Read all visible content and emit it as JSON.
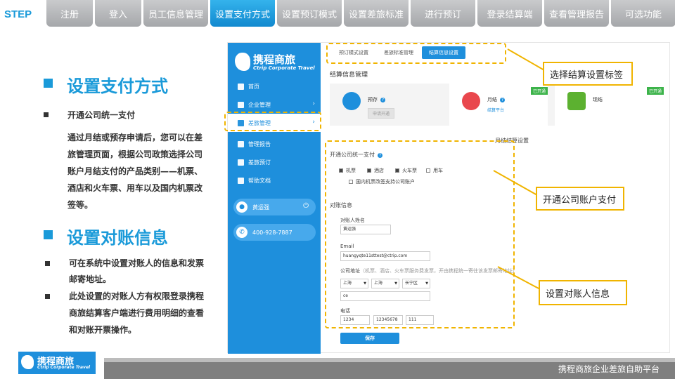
{
  "step_bar": {
    "label": "STEP",
    "tabs": [
      "注册",
      "登入",
      "员工信息管理",
      "设置支付方式",
      "设置预订模式",
      "设置差旅标准",
      "进行预订",
      "登录结算端",
      "查看管理报告",
      "可选功能"
    ],
    "active_index": 3
  },
  "left_panel": {
    "section1_title": "设置支付方式",
    "section1_bullet": "开通公司统一支付",
    "section1_body": [
      "通过月结或预存申请后，您可以在差",
      "旅管理页面，根据公司政策选择公司",
      "账户月结支付的产品类别——机票、",
      "酒店和火车票、用车以及国内机票改",
      "签等。"
    ],
    "section2_title": "设置对账信息",
    "section2_bullet1": [
      "可在系统中设置对账人的信息和发票",
      "邮寄地址。"
    ],
    "section2_bullet2": [
      "此处设置的对账人方有权限登录携程",
      "商旅结算客户端进行费用明细的查看",
      "和对账开票操作。"
    ]
  },
  "app": {
    "logo_main": "携程商旅",
    "logo_sub": "Ctrip Corporate Travel",
    "nav": [
      {
        "label": "首页",
        "icon": "home-icon"
      },
      {
        "label": "企业管理",
        "icon": "users-icon"
      },
      {
        "label": "差旅管理",
        "icon": "briefcase-icon"
      },
      {
        "label": "管理报告",
        "icon": "report-icon"
      },
      {
        "label": "差旅预订",
        "icon": "booking-icon"
      },
      {
        "label": "帮助文档",
        "icon": "book-icon"
      }
    ],
    "user_name": "黄运强",
    "phone": "400-928-7887",
    "subtabs": [
      "预订模式设置",
      "差旅标准管理",
      "结算信息设置"
    ],
    "active_subtab": 2,
    "mgmt_title": "结算信息管理",
    "cards": [
      {
        "title": "预存",
        "action": "申请开通",
        "badge": ""
      },
      {
        "title": "月结",
        "action": "结算平台",
        "badge": "已开通"
      },
      {
        "title": "现结",
        "action": "",
        "badge": "已开通"
      }
    ],
    "caption_mid": "月结结算设置",
    "unified_pay_label": "开通公司统一支付",
    "products": [
      "机票",
      "酒店",
      "火车票",
      "用车"
    ],
    "products_checked": [
      true,
      true,
      true,
      false
    ],
    "intl_change_option": "国内机票改签支持公司账户",
    "recon_title": "对账信息",
    "recon_person_label": "对账人姓名",
    "recon_person_value": "黄运强",
    "email_label": "Email",
    "email_value": "huangyqte11sttest@ctrip.com",
    "address_label": "公司地址",
    "address_hint": "（机票、酒店、火车票服务费发票，开由携程统一寄往该发票邮寄地址）",
    "addr_province": "上海",
    "addr_city": "上海",
    "addr_district": "长宁区",
    "addr_detail": "ce",
    "phone_label": "电话",
    "phone_area": "1234",
    "phone_number": "12345678",
    "phone_ext": "111",
    "save_label": "保存"
  },
  "callouts": {
    "tab_label": "选择结算设置标签",
    "account_pay": "开通公司账户支付",
    "recon_info": "设置对账人信息"
  },
  "footer": {
    "logo_main": "携程商旅",
    "logo_sub": "Ctrip Corporate Travel",
    "platform": "携程商旅企业差旅自助平台"
  },
  "colors": {
    "accent": "#1a9ad9",
    "tab_inactive": "#b7b8ba",
    "callout_border": "#f0b400",
    "sidebar": "#1e8fdc"
  }
}
